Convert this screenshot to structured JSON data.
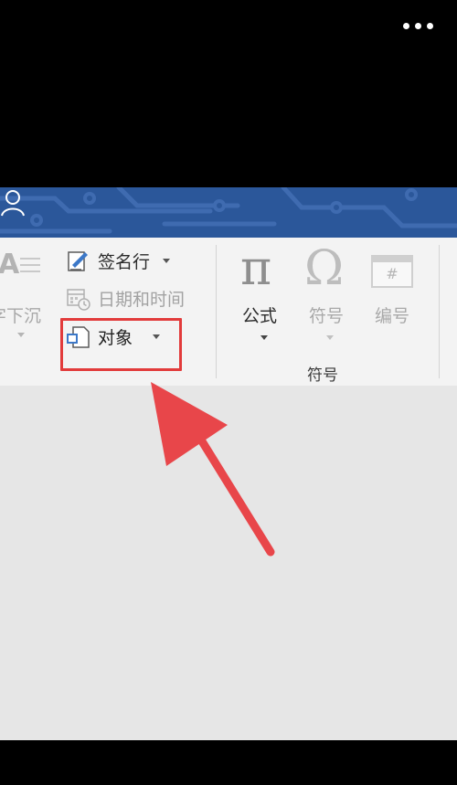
{
  "ribbon": {
    "cut_group": {
      "label": "字下沉"
    },
    "text_group": {
      "signature_line": "签名行",
      "date_time": "日期和时间",
      "object": "对象"
    },
    "symbols_group": {
      "formula": "公式",
      "symbol": "符号",
      "number": "编号",
      "group_label": "符号",
      "formula_glyph": "π",
      "symbol_glyph": "Ω",
      "number_glyph": "#"
    }
  },
  "annotation": {
    "highlight_color": "#e23b3b",
    "arrow_color": "#e8464a"
  },
  "colors": {
    "title_bar": "#2b579a",
    "ribbon_bg": "#f3f3f3",
    "content_bg": "#e6e6e6"
  }
}
